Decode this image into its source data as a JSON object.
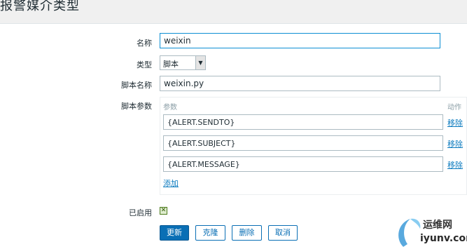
{
  "header": {
    "title": "报警媒介类型"
  },
  "form": {
    "name_label": "名称",
    "name_value": "weixin",
    "type_label": "类型",
    "type_selected": "脚本",
    "script_name_label": "脚本名称",
    "script_name_value": "weixin.py",
    "params_label": "脚本参数",
    "params_col_header": "参数",
    "action_col_header": "动作",
    "params": [
      {
        "value": "{ALERT.SENDTO}",
        "remove_label": "移除"
      },
      {
        "value": "{ALERT.SUBJECT}",
        "remove_label": "移除"
      },
      {
        "value": "{ALERT.MESSAGE}",
        "remove_label": "移除"
      }
    ],
    "add_label": "添加",
    "enabled_label": "已启用",
    "enabled_checked": true
  },
  "buttons": {
    "update": "更新",
    "clone": "克隆",
    "delete": "删除",
    "cancel": "取消"
  },
  "watermark": {
    "line1": "运维网",
    "line2": "iyunv.com"
  },
  "colors": {
    "accent": "#0a6fb5",
    "link": "#0c7bbf",
    "focus_border": "#0c8ed4",
    "check_green": "#4c7b1b"
  }
}
